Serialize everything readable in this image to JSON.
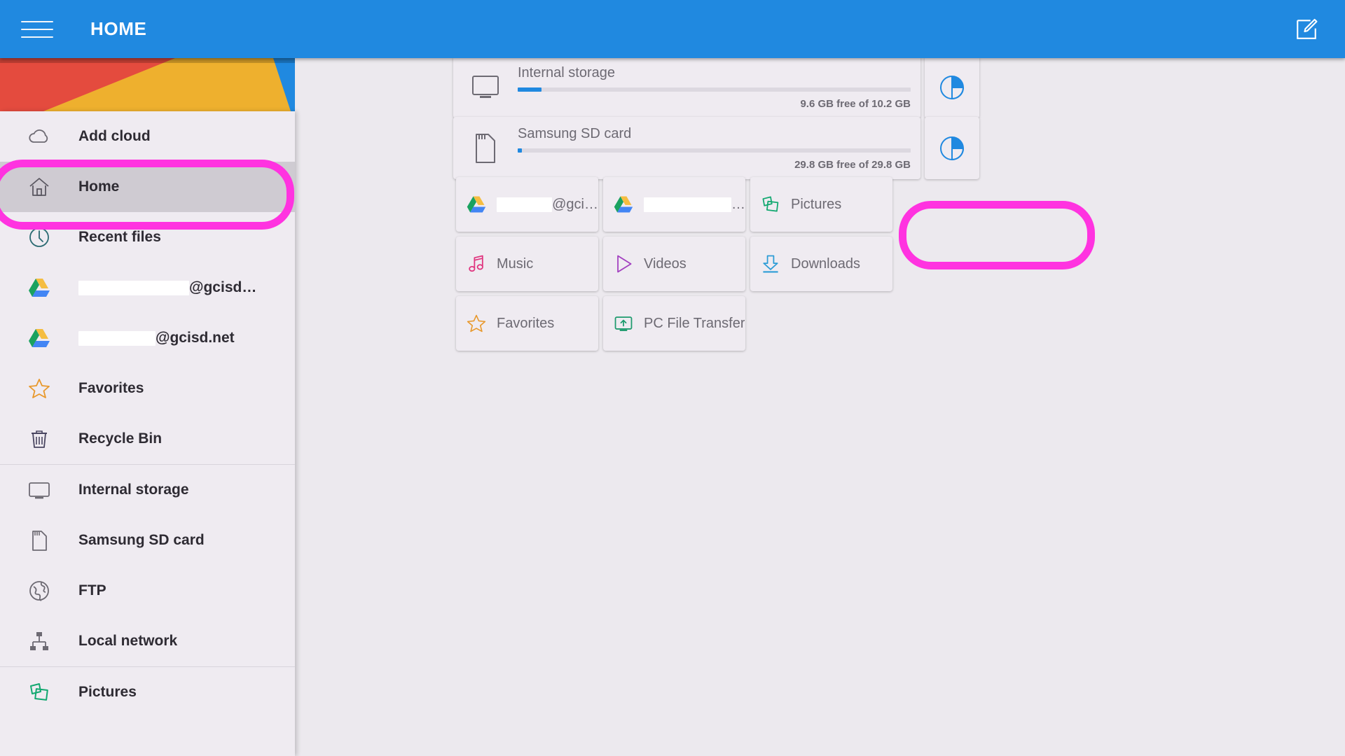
{
  "app": {
    "title": "HOME",
    "menu_icon": "hamburger-icon",
    "edit_icon": "edit-icon",
    "accent_blue": "#2089e0",
    "annotation_color": "#ff33e0"
  },
  "sidebar": {
    "groups": [
      {
        "items": [
          {
            "label": "Add cloud",
            "icon": "cloud-icon",
            "selected": false
          },
          {
            "label": "Home",
            "icon": "home-icon",
            "selected": true
          },
          {
            "label": "Recent files",
            "icon": "clock-icon",
            "selected": false
          },
          {
            "label": "@gcisd…",
            "icon": "google-drive-icon",
            "selected": false,
            "redacted": true,
            "redact_width": 158
          },
          {
            "label": "@gcisd.net",
            "icon": "google-drive-icon",
            "selected": false,
            "redacted": true,
            "redact_width": 110
          },
          {
            "label": "Favorites",
            "icon": "star-icon",
            "selected": false
          },
          {
            "label": "Recycle Bin",
            "icon": "trash-icon",
            "selected": false
          }
        ]
      },
      {
        "items": [
          {
            "label": "Internal storage",
            "icon": "monitor-icon",
            "selected": false
          },
          {
            "label": "Samsung SD card",
            "icon": "sd-card-icon",
            "selected": false
          },
          {
            "label": "FTP",
            "icon": "globe-icon",
            "selected": false
          },
          {
            "label": "Local network",
            "icon": "network-icon",
            "selected": false
          }
        ]
      },
      {
        "items": [
          {
            "label": "Pictures",
            "icon": "pictures-icon",
            "selected": false
          }
        ]
      }
    ]
  },
  "main": {
    "storage": [
      {
        "name": "Internal storage",
        "icon": "monitor-icon",
        "free_text": "9.6 GB free of 10.2 GB",
        "used_percent": 6,
        "pie_icon": "pie-chart-icon"
      },
      {
        "name": "Samsung SD card",
        "icon": "sd-card-icon",
        "free_text": "29.8 GB free of 29.8 GB",
        "used_percent": 1,
        "pie_icon": "pie-chart-icon"
      }
    ],
    "tiles": [
      [
        {
          "label": "@gci…",
          "icon": "google-drive-icon",
          "redacted": true,
          "redact_width": 112,
          "highlighted": false
        },
        {
          "label": "…",
          "icon": "google-drive-icon",
          "redacted": true,
          "redact_width": 146,
          "highlighted": false
        },
        {
          "label": "Pictures",
          "icon": "pictures-icon",
          "redacted": false,
          "highlighted": true
        }
      ],
      [
        {
          "label": "Music",
          "icon": "music-note-icon",
          "redacted": false,
          "highlighted": false
        },
        {
          "label": "Videos",
          "icon": "play-triangle-icon",
          "redacted": false,
          "highlighted": false
        },
        {
          "label": "Downloads",
          "icon": "download-arrow-icon",
          "redacted": false,
          "highlighted": false
        }
      ],
      [
        {
          "label": "Favorites",
          "icon": "star-icon",
          "redacted": false,
          "highlighted": false
        },
        {
          "label": "PC File Transfer",
          "icon": "pc-transfer-icon",
          "redacted": false,
          "highlighted": false
        }
      ]
    ]
  }
}
